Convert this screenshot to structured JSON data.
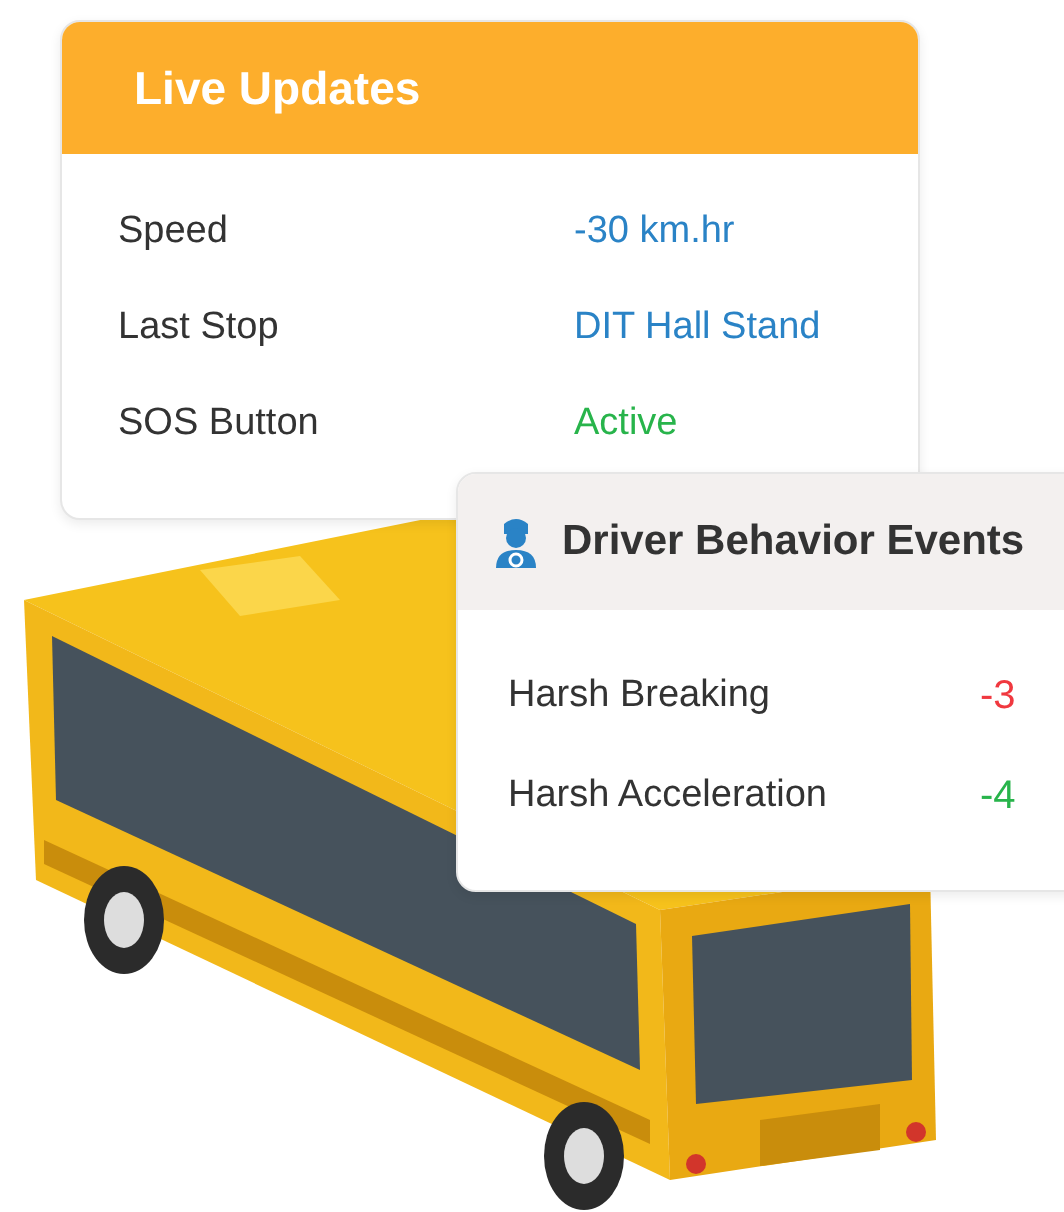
{
  "live_updates": {
    "title": "Live Updates",
    "rows": [
      {
        "label": "Speed",
        "value": "-30 km.hr",
        "color": "#2a83c6"
      },
      {
        "label": "Last Stop",
        "value": "DIT Hall Stand",
        "color": "#2a83c6"
      },
      {
        "label": "SOS Button",
        "value": "Active",
        "color": "#28b44b"
      }
    ]
  },
  "driver_behavior": {
    "title": "Driver Behavior Events",
    "rows": [
      {
        "label": "Harsh Breaking",
        "value": "-3",
        "color": "#f0383f"
      },
      {
        "label": "Harsh Acceleration",
        "value": "-4",
        "color": "#28b44b"
      }
    ]
  }
}
